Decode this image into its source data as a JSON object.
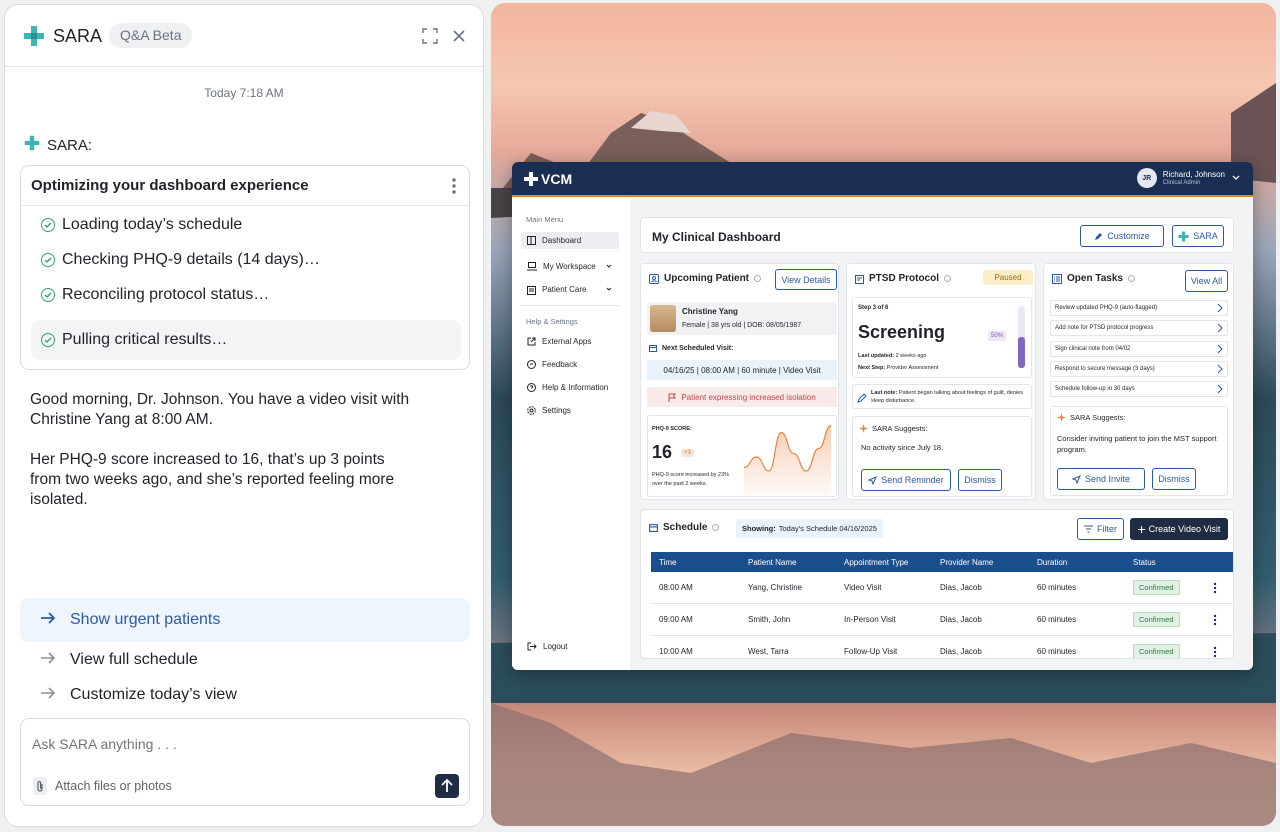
{
  "chat": {
    "app_name": "SARA",
    "badge": "Q&A Beta",
    "timestamp": "Today 7:18 AM",
    "sender": "SARA:",
    "card_title": "Optimizing your dashboard experience",
    "steps": [
      {
        "label": "Loading today’s schedule"
      },
      {
        "label": "Checking PHQ-9 details (14 days)…"
      },
      {
        "label": "Reconciling protocol status…"
      },
      {
        "label": "Pulling critical results…"
      }
    ],
    "message_p1": "Good morning, Dr. Johnson. You have a video visit with Christine Yang at 8:00 AM.",
    "message_p2": "Her PHQ-9 score increased to 16, that’s up 3 points from two weeks ago, and she’s reported feeling more isolated.",
    "suggestions": [
      {
        "label": "Show urgent patients"
      },
      {
        "label": "View full schedule"
      },
      {
        "label": "Customize today’s view"
      }
    ],
    "input_placeholder": "Ask SARA anything . . .",
    "attach_label": "Attach files or photos"
  },
  "app": {
    "logo": "VCM",
    "user_name": "Richard, Johnson",
    "user_role": "Clinical Admin",
    "user_initials": "JR",
    "sidebar": {
      "main_menu": "Main Menu",
      "items": [
        {
          "label": "Dashboard"
        },
        {
          "label": "My Workspace"
        },
        {
          "label": "Patient Care"
        }
      ],
      "help_header": "Help & Settings",
      "help_items": [
        {
          "label": "External Apps"
        },
        {
          "label": "Feedback"
        },
        {
          "label": "Help & Information"
        },
        {
          "label": "Settings"
        }
      ],
      "logout": "Logout"
    },
    "dashboard_title": "My Clinical Dashboard",
    "customize_label": "Customize",
    "sara_label": "SARA",
    "patient_panel": {
      "title": "Upcoming Patient",
      "view_details": "View Details",
      "name": "Christine Yang",
      "info": "Female | 38 yrs old | DOB: 08/05/1987",
      "next_visit_label": "Next Scheduled Visit:",
      "next_visit": "04/16/25 | 08:00 AM | 60 minute | Video Visit",
      "alert": "Patient expressing increased isolation",
      "score_label": "PHQ-9 SCORE:",
      "score": "16",
      "delta": "+3",
      "score_note": "PHQ-9 score increased by 23% over the past 2 weeks.",
      "trend": [
        0.35,
        0.5,
        0.3,
        0.85,
        0.55,
        0.3,
        0.62,
        0.95
      ]
    },
    "ptsd_panel": {
      "title": "PTSD Protocol",
      "status": "Paused",
      "step": "Step 3 of 6",
      "stage": "Screening",
      "progress_label": "50%",
      "progress": 0.5,
      "updated_label": "Last updated:",
      "updated": "2 weeks ago",
      "next_label": "Next Step:",
      "next": "Provider Assessment",
      "note_label": "Last note:",
      "note": "Patient began talking about feelings of guilt, denies sleep disturbance.",
      "suggest_title": "SARA Suggests:",
      "suggest_text": "No activity since July 18.",
      "send_reminder": "Send Reminder",
      "dismiss": "Dismiss"
    },
    "tasks_panel": {
      "title": "Open Tasks",
      "view_all": "View All",
      "tasks": [
        {
          "label": "Review updated PHQ-9 (auto-flagged)"
        },
        {
          "label": "Add note for PTSD protocol progress"
        },
        {
          "label": "Sign clinical note from 04/02"
        },
        {
          "label": "Respond to secure message (3 days)"
        },
        {
          "label": "Schedule follow-up in 30 days"
        }
      ],
      "suggest_title": "SARA Suggests:",
      "suggest_text": "Consider inviting patient to join the MST support program.",
      "send_invite": "Send Invite",
      "dismiss": "Dismiss"
    },
    "schedule": {
      "title": "Schedule",
      "showing_label": "Showing:",
      "showing": "Today's Schedule 04/16/2025",
      "filter": "Filter",
      "create": "Create Video Visit",
      "columns": [
        "Time",
        "Patient Name",
        "Appointment Type",
        "Provider Name",
        "Duration",
        "Status"
      ],
      "rows": [
        {
          "time": "08:00 AM",
          "patient": "Yang, Christine",
          "type": "Video Visit",
          "provider": "Dias, Jacob",
          "duration": "60 minutes",
          "status": "Confirmed"
        },
        {
          "time": "09:00 AM",
          "patient": "Smith, John",
          "type": "In-Person Visit",
          "provider": "Dias, Jacob",
          "duration": "60 minutes",
          "status": "Confirmed"
        },
        {
          "time": "10:00 AM",
          "patient": "West, Tarra",
          "type": "Follow-Up Visit",
          "provider": "Dias, Jacob",
          "duration": "60 minutes",
          "status": "Confirmed"
        }
      ]
    }
  },
  "colors": {
    "navy": "#1a2d52",
    "accent": "#2a5aa5",
    "teal": "#3cb6b0",
    "orange": "#d98a2f"
  }
}
